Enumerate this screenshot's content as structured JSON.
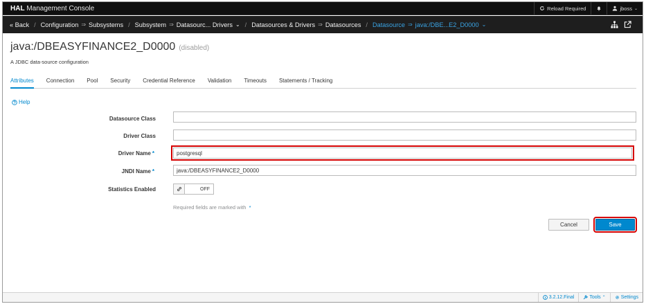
{
  "app": {
    "brand_bold": "HAL",
    "brand_rest": "Management Console"
  },
  "topbar": {
    "reload": "Reload Required",
    "user": "jboss"
  },
  "breadcrumb": {
    "back": "« Back",
    "configuration": "Configuration",
    "subsystems": "Subsystems",
    "subsystem": "Subsystem",
    "datasources_drivers": "Datasourc... Drivers",
    "datasources_and_drivers": "Datasources & Drivers",
    "datasources": "Datasources",
    "datasource": "Datasource",
    "current": "java:/DBE...E2_D0000"
  },
  "page": {
    "title": "java:/DBEASYFINANCE2_D0000",
    "state": "(disabled)",
    "subtitle": "A JDBC data-source configuration"
  },
  "tabs": [
    "Attributes",
    "Connection",
    "Pool",
    "Security",
    "Credential Reference",
    "Validation",
    "Timeouts",
    "Statements / Tracking"
  ],
  "help_label": "Help",
  "form": {
    "datasource_class_label": "Datasource Class",
    "datasource_class_value": "",
    "driver_class_label": "Driver Class",
    "driver_class_value": "",
    "driver_name_label": "Driver Name",
    "driver_name_value": "postgresql",
    "jndi_name_label": "JNDI Name",
    "jndi_name_value": "java:/DBEASYFINANCE2_D0000",
    "statistics_label": "Statistics Enabled",
    "statistics_value": "OFF",
    "required_note": "Required fields are marked with",
    "required_marker": "*"
  },
  "buttons": {
    "cancel": "Cancel",
    "save": "Save"
  },
  "footer": {
    "version": "3.2.12.Final",
    "tools": "Tools",
    "settings": "Settings"
  },
  "colors": {
    "accent": "#0088ce",
    "highlight": "#d50000",
    "topbar": "#101010",
    "crumbbar": "#1e1e1e"
  }
}
